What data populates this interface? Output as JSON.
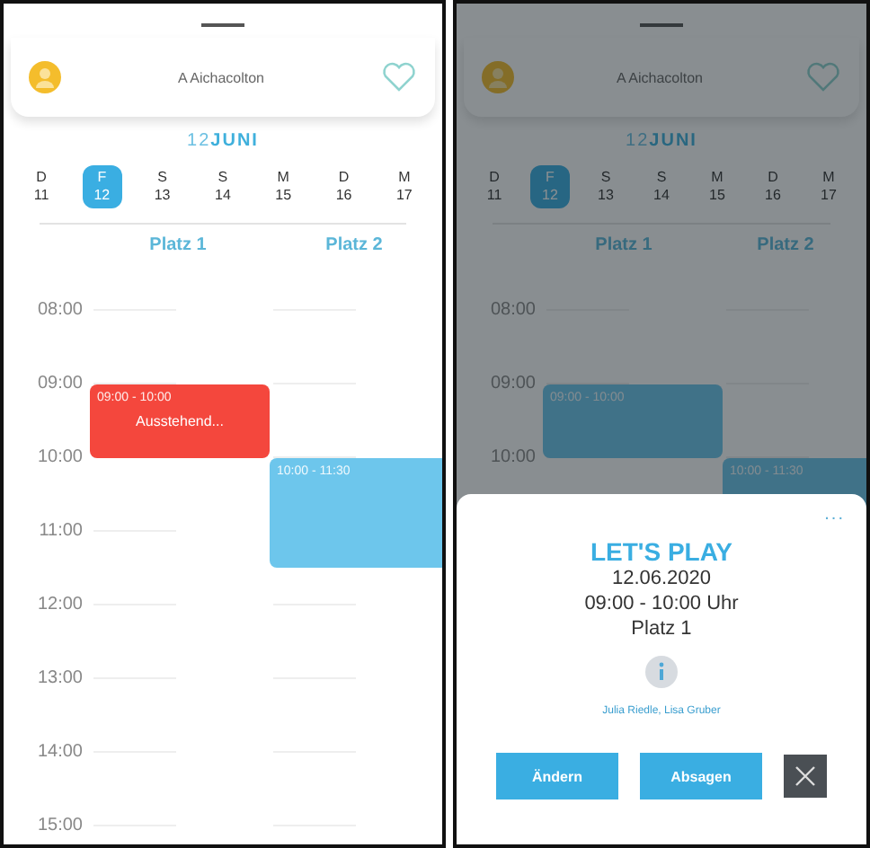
{
  "screens": [
    {
      "header": {
        "title": "A Aichacolton"
      },
      "month": "12**JUNI**",
      "dimmed": false,
      "days": [
        {
          "letter": "D",
          "date": "11",
          "selected": false
        },
        {
          "letter": "F",
          "date": "12",
          "selected": true
        },
        {
          "letter": "S",
          "date": "13",
          "selected": false
        },
        {
          "letter": "S",
          "date": "14",
          "selected": false
        },
        {
          "letter": "M",
          "date": "15",
          "selected": false
        },
        {
          "letter": "D",
          "date": "16",
          "selected": false
        },
        {
          "letter": "M",
          "date": "17",
          "selected": false
        }
      ],
      "hours": [
        "08:00",
        "09:00",
        "10:00",
        "11:00",
        "12:00",
        "13:00",
        "14:00",
        "15:00"
      ],
      "courts": [
        {
          "name": "Platz 1",
          "events": [
            {
              "kind": "pending",
              "time": "09:00 - 10:00",
              "label": "Ausstehend..."
            }
          ]
        },
        {
          "name": "Platz 2",
          "events": [
            {
              "kind": "booked",
              "time": "10:00 - 11:30"
            }
          ]
        }
      ]
    },
    {
      "header": {
        "title": "A Aichacolton"
      },
      "month": "12**JUNI**",
      "dimmed": true,
      "days": [
        {
          "letter": "D",
          "date": "11",
          "selected": false
        },
        {
          "letter": "F",
          "date": "12",
          "selected": true
        },
        {
          "letter": "S",
          "date": "13",
          "selected": false
        },
        {
          "letter": "S",
          "date": "14",
          "selected": false
        },
        {
          "letter": "M",
          "date": "15",
          "selected": false
        },
        {
          "letter": "D",
          "date": "16",
          "selected": false
        },
        {
          "letter": "M",
          "date": "17",
          "selected": false
        }
      ],
      "hours": [
        "08:00",
        "09:00",
        "10:00"
      ],
      "courts": [
        {
          "name": "Platz 1",
          "events": [
            {
              "kind": "booked",
              "time": "09:00 - 10:00"
            }
          ]
        },
        {
          "name": "Platz 2",
          "events": [
            {
              "kind": "booked",
              "time": "10:00 - 11:30"
            }
          ]
        }
      ],
      "sheet": {
        "menu": "...",
        "title": "LET'S PLAY",
        "date": "12.06.2020",
        "time": "09:00 - 10:00 Uhr",
        "court": "Platz 1",
        "players": "Julia Riedle, Lisa Gruber",
        "buttons": [
          "Ändern",
          "Absagen"
        ]
      }
    }
  ]
}
